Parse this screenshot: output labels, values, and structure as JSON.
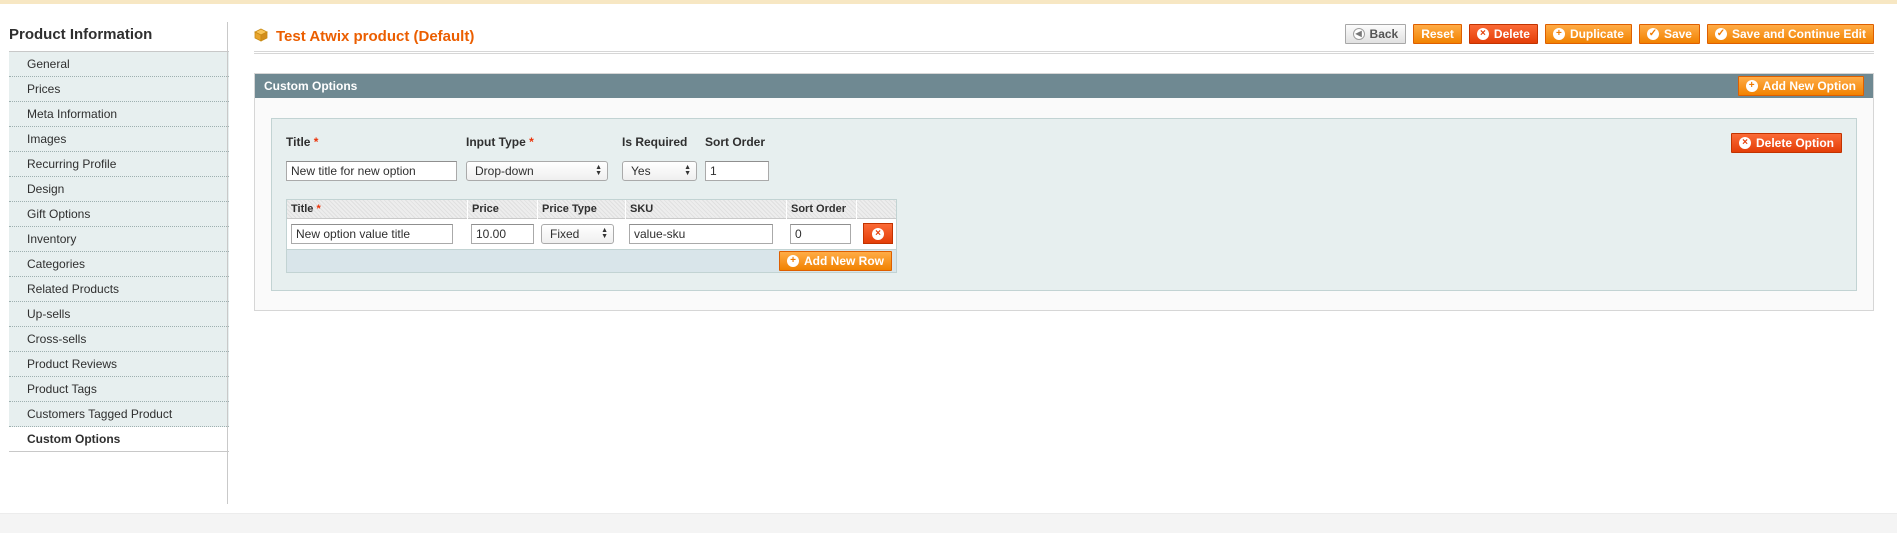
{
  "sidebar": {
    "title": "Product Information",
    "items": [
      {
        "label": "General"
      },
      {
        "label": "Prices"
      },
      {
        "label": "Meta Information"
      },
      {
        "label": "Images"
      },
      {
        "label": "Recurring Profile"
      },
      {
        "label": "Design"
      },
      {
        "label": "Gift Options"
      },
      {
        "label": "Inventory"
      },
      {
        "label": "Categories"
      },
      {
        "label": "Related Products"
      },
      {
        "label": "Up-sells"
      },
      {
        "label": "Cross-sells"
      },
      {
        "label": "Product Reviews"
      },
      {
        "label": "Product Tags"
      },
      {
        "label": "Customers Tagged Product"
      },
      {
        "label": "Custom Options",
        "active": true
      }
    ]
  },
  "header": {
    "title": "Test Atwix product (Default)",
    "icon": "product-box-icon",
    "buttons": {
      "back": "Back",
      "reset": "Reset",
      "delete": "Delete",
      "duplicate": "Duplicate",
      "save": "Save",
      "save_continue": "Save and Continue Edit"
    }
  },
  "custom_options": {
    "section_title": "Custom Options",
    "add_new_option": "Add New Option",
    "option": {
      "title_label": "Title",
      "input_type_label": "Input Type",
      "is_required_label": "Is Required",
      "sort_order_label": "Sort Order",
      "required_marker": "*",
      "title_value": "New title for new option",
      "input_type_value": "Drop-down",
      "is_required_value": "Yes",
      "sort_order_value": "1",
      "delete_option": "Delete Option"
    },
    "values_table": {
      "columns": {
        "title": "Title",
        "price": "Price",
        "price_type": "Price Type",
        "sku": "SKU",
        "sort_order": "Sort Order"
      },
      "row": {
        "title": "New option value title",
        "price": "10.00",
        "price_type": "Fixed",
        "sku": "value-sku",
        "sort_order": "0"
      },
      "add_new_row": "Add New Row"
    }
  },
  "colors": {
    "accent_orange": "#f18200",
    "delete_red": "#e43e08",
    "section_header": "#6f8992",
    "panel_bg": "#e7efef",
    "title_orange": "#eb5e00"
  }
}
